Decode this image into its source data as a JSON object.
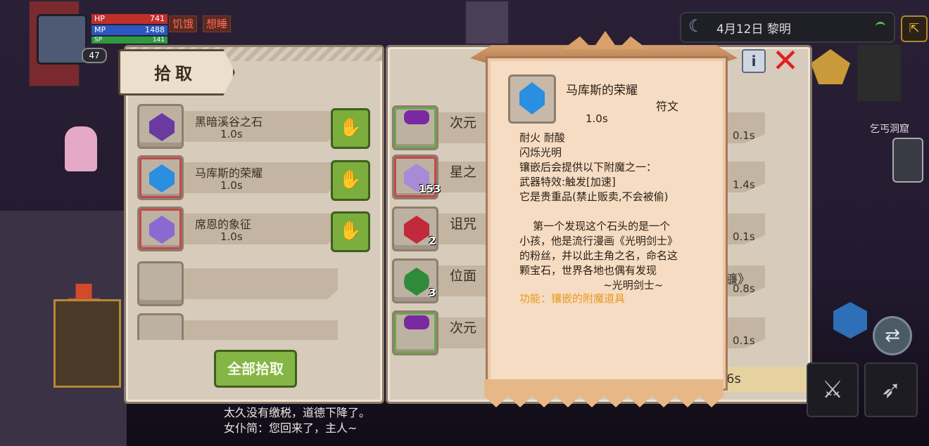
{
  "status": {
    "hp_label": "HP",
    "hp_value": "741",
    "mp_label": "MP",
    "mp_value": "1488",
    "sp_label": "SP",
    "sp_value": "141",
    "level": "47",
    "debuffs": [
      "饥饿",
      "想睡"
    ]
  },
  "world": {
    "date_time": "4月12日  黎明",
    "location": "乞丐洞窟"
  },
  "pickup_panel": {
    "title": "拾取",
    "items": [
      {
        "name": "黑暗溪谷之石",
        "time": "1.0s"
      },
      {
        "name": "马库斯的荣耀",
        "time": "1.0s"
      },
      {
        "name": "席恩的象征",
        "time": "1.0s"
      }
    ],
    "pick_all_label": "全部拾取"
  },
  "inventory_panel": {
    "items": [
      {
        "name": "次元",
        "count": "",
        "time": "0.1s"
      },
      {
        "name": "星之",
        "count": "153",
        "time": "1.4s"
      },
      {
        "name": "诅咒",
        "count": "2",
        "time": "0.1s"
      },
      {
        "name": "位面",
        "count": "3",
        "time": "0.8s"
      },
      {
        "name": "次元",
        "count": "",
        "time": "0.1s"
      }
    ],
    "right_fragment": "镰》",
    "bottom_fragment": "6s"
  },
  "tooltip": {
    "name": "马库斯的荣耀",
    "type": "符文",
    "time": "1.0s",
    "lines": [
      "耐火  耐酸",
      "闪烁光明",
      "镶嵌后会提供以下附魔之一：",
      "武器特效:触发[加速]",
      "它是贵重品(禁止贩卖,不会被偷)",
      "",
      "    第一个发现这个石头的是一个",
      "小孩，他是流行漫画《光明剑士》",
      "的粉丝，并以此主角之名，命名这",
      "颗宝石，世界各地也偶有发现",
      "                         ~光明剑士~"
    ],
    "function": "功能：镶嵌的附魔道具",
    "info_label": "i"
  },
  "messages": [
    "太久没有缴税，道德下降了。",
    "女仆简：您回来了，主人~"
  ]
}
